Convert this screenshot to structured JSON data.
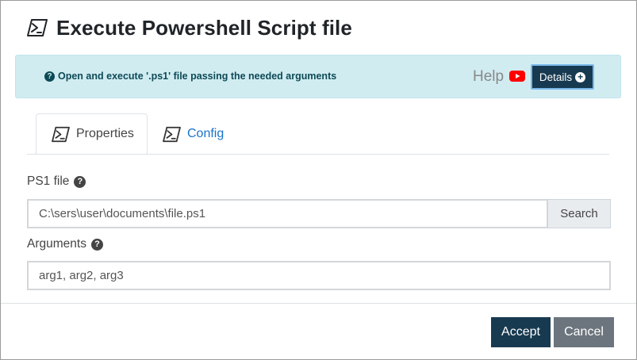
{
  "dialog": {
    "title": "Execute Powershell Script file"
  },
  "info": {
    "text": "Open and execute '.ps1' file passing the needed arguments",
    "help_label": "Help",
    "details_label": "Details"
  },
  "tabs": [
    {
      "label": "Properties",
      "active": true
    },
    {
      "label": "Config",
      "active": false
    }
  ],
  "form": {
    "ps1_label": "PS1 file",
    "ps1_value": "C:\\sers\\user\\documents\\file.ps1",
    "search_label": "Search",
    "arguments_label": "Arguments",
    "arguments_value": "arg1, arg2, arg3"
  },
  "footer": {
    "accept_label": "Accept",
    "cancel_label": "Cancel"
  },
  "icons": {
    "title": "powershell-icon",
    "info": "question-circle-icon",
    "help_video": "youtube-icon",
    "details": "plus-circle-icon"
  },
  "colors": {
    "primary": "#173a50",
    "info_bg": "#d1ecf1",
    "info_text": "#0c4a56",
    "link": "#1a73c9",
    "secondary": "#6c757d",
    "youtube": "#ff0000"
  }
}
